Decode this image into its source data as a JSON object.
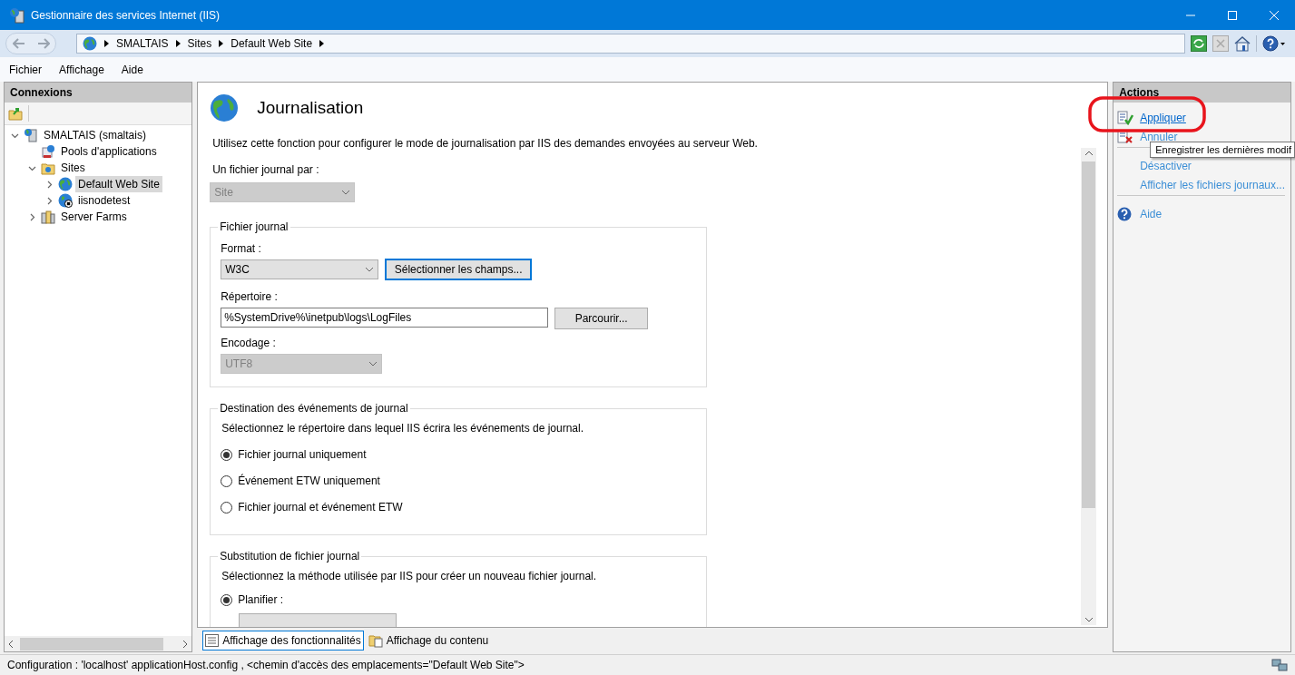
{
  "window": {
    "title": "Gestionnaire des services Internet (IIS)"
  },
  "breadcrumb": [
    "SMALTAIS",
    "Sites",
    "Default Web Site"
  ],
  "menu": [
    "Fichier",
    "Affichage",
    "Aide"
  ],
  "connections": {
    "title": "Connexions",
    "tree": [
      {
        "label": "SMALTAIS (smaltais)",
        "kind": "server",
        "expanded": true,
        "selected": false,
        "children": [
          {
            "label": "Pools d'applications",
            "kind": "pool",
            "selected": false
          },
          {
            "label": "Sites",
            "kind": "folder",
            "expanded": true,
            "selected": false,
            "children": [
              {
                "label": "Default Web Site",
                "kind": "site",
                "expanded": false,
                "selected": true
              },
              {
                "label": "iisnodetest",
                "kind": "site-stopped",
                "expanded": false,
                "selected": false
              }
            ]
          },
          {
            "label": "Server Farms",
            "kind": "farm",
            "expanded": false,
            "selected": false
          }
        ]
      }
    ]
  },
  "feature": {
    "title": "Journalisation",
    "description": "Utilisez cette fonction pour configurer le mode de journalisation par IIS des demandes envoyées au serveur Web.",
    "log_per_label": "Un fichier journal par :",
    "log_per_value": "Site",
    "log_file": {
      "legend": "Fichier journal",
      "format_label": "Format :",
      "format_value": "W3C",
      "select_fields_button": "Sélectionner les champs...",
      "directory_label": "Répertoire :",
      "directory_value": "%SystemDrive%\\inetpub\\logs\\LogFiles",
      "browse_button": "Parcourir...",
      "encoding_label": "Encodage :",
      "encoding_value": "UTF8"
    },
    "destination": {
      "legend": "Destination des événements de journal",
      "description": "Sélectionnez le répertoire dans lequel IIS écrira les événements de journal.",
      "options": [
        {
          "label": "Fichier journal uniquement",
          "selected": true
        },
        {
          "label": "Événement ETW uniquement",
          "selected": false
        },
        {
          "label": "Fichier journal et événement ETW",
          "selected": false
        }
      ]
    },
    "rollover": {
      "legend": "Substitution de fichier journal",
      "description": "Sélectionnez la méthode utilisée par IIS pour créer un nouveau fichier journal.",
      "options": [
        {
          "label": "Planifier :",
          "selected": true
        }
      ]
    }
  },
  "view_tabs": [
    {
      "label": "Affichage des fonctionnalités",
      "kind": "features",
      "selected": true
    },
    {
      "label": "Affichage du contenu",
      "kind": "content",
      "selected": false
    }
  ],
  "actions": {
    "title": "Actions",
    "groups": [
      [
        {
          "label": "Appliquer",
          "kind": "apply"
        },
        {
          "label": "Annuler",
          "kind": "cancel"
        }
      ],
      [
        {
          "label": "Désactiver",
          "kind": "plain"
        },
        {
          "label": "Afficher les fichiers journaux...",
          "kind": "plain"
        }
      ],
      [
        {
          "label": "Aide",
          "kind": "help"
        }
      ]
    ]
  },
  "tooltip": "Enregistrer les dernières modif",
  "status_bar": "Configuration : 'localhost' applicationHost.config , <chemin d'accès des emplacements=\"Default Web Site\">"
}
